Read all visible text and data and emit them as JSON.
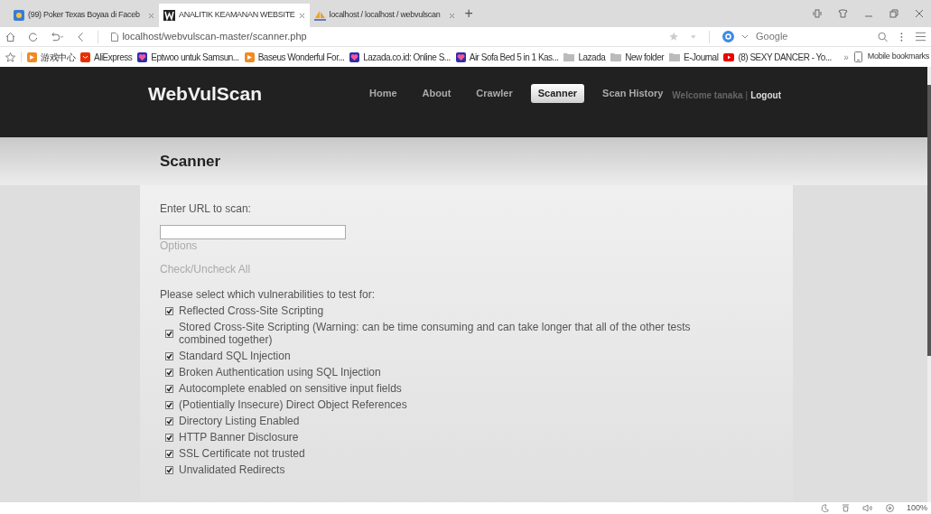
{
  "browser": {
    "tabs": [
      {
        "label": "(99) Poker Texas Boyaa di Faceb",
        "kind": "game",
        "selected": false
      },
      {
        "label": "ANALITIK KEAMANAN WEBSITE",
        "kind": "w",
        "selected": true
      },
      {
        "label": "localhost / localhost / webvulscan",
        "kind": "pma",
        "selected": false
      }
    ],
    "new_tab": "+",
    "address": "localhost/webvulscan-master/scanner.php",
    "search_placeholder": "Google",
    "bookmarks": [
      {
        "label": "游戏中心",
        "kind": "orange"
      },
      {
        "label": "AliExpress",
        "kind": "red"
      },
      {
        "label": "Eptwoo untuk Samsun...",
        "kind": "lazada"
      },
      {
        "label": "Baseus Wonderful For...",
        "kind": "orange"
      },
      {
        "label": "Lazada.co.id: Online S...",
        "kind": "lazada"
      },
      {
        "label": "Air Sofa Bed 5 in 1 Kas...",
        "kind": "lazada"
      },
      {
        "label": "Lazada",
        "kind": "folder"
      },
      {
        "label": "New folder",
        "kind": "folder"
      },
      {
        "label": "E-Journal",
        "kind": "folder"
      },
      {
        "label": "(8) SEXY DANCER - Yo...",
        "kind": "video"
      }
    ],
    "more": "»",
    "mobile_bookmarks": "Mobile bookmarks",
    "zoom": "100%"
  },
  "site": {
    "logo": "WebVulScan",
    "nav": [
      {
        "label": "Home",
        "selected": false
      },
      {
        "label": "About",
        "selected": false
      },
      {
        "label": "Crawler",
        "selected": false
      },
      {
        "label": "Scanner",
        "selected": true
      },
      {
        "label": "Scan History",
        "selected": false
      }
    ],
    "welcome": "Welcome tanaka",
    "separator": "|",
    "logout": "Logout",
    "page_title": "Scanner",
    "url_label": "Enter URL to scan:",
    "options": "Options",
    "check_all": "Check/Uncheck All",
    "prompt": "Please select which vulnerabilities to test for:",
    "tests": [
      {
        "label": "Reflected Cross-Site Scripting",
        "checked": true
      },
      {
        "label": "Stored Cross-Site Scripting (Warning: can be time consuming and can take longer that all of the other tests combined together)",
        "checked": true
      },
      {
        "label": "Standard SQL Injection",
        "checked": true
      },
      {
        "label": "Broken Authentication using SQL Injection",
        "checked": true
      },
      {
        "label": "Autocomplete enabled on sensitive input fields",
        "checked": true
      },
      {
        "label": "(Potientially Insecure) Direct Object References",
        "checked": true
      },
      {
        "label": "Directory Listing Enabled",
        "checked": true
      },
      {
        "label": "HTTP Banner Disclosure",
        "checked": true
      },
      {
        "label": "SSL Certificate not trusted",
        "checked": true
      },
      {
        "label": "Unvalidated Redirects",
        "checked": true
      }
    ]
  }
}
